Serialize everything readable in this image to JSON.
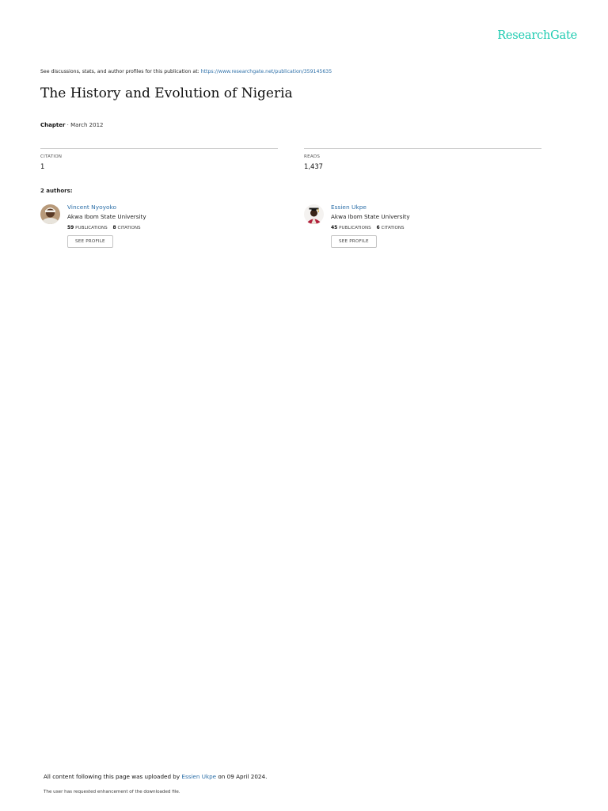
{
  "header": {
    "logo_text": "ResearchGate",
    "brand_color": "#1ccbb0"
  },
  "discussion": {
    "prefix": "See discussions, stats, and author profiles for this publication at:",
    "url": "https://www.researchgate.net/publication/359145635"
  },
  "publication": {
    "title": "The History and Evolution of Nigeria",
    "type": "Chapter",
    "separator": " · ",
    "date": "March 2012"
  },
  "stats": {
    "citation_label": "CITATION",
    "citation_value": "1",
    "reads_label": "READS",
    "reads_value": "1,437"
  },
  "authors": {
    "heading": "2 authors:",
    "list": [
      {
        "name": "Vincent Nyoyoko",
        "institution": "Akwa Ibom State University",
        "publications": "59",
        "publications_label": "PUBLICATIONS",
        "citations": "8",
        "citations_label": "CITATIONS",
        "button_label": "SEE PROFILE"
      },
      {
        "name": "Essien Ukpe",
        "institution": "Akwa Ibom State University",
        "publications": "45",
        "publications_label": "PUBLICATIONS",
        "citations": "6",
        "citations_label": "CITATIONS",
        "button_label": "SEE PROFILE"
      }
    ]
  },
  "footer": {
    "upload_prefix": "All content following this page was uploaded by",
    "uploader": "Essien Ukpe",
    "upload_suffix": "on 09 April 2024.",
    "enhancement_note": "The user has requested enhancement of the downloaded file."
  }
}
